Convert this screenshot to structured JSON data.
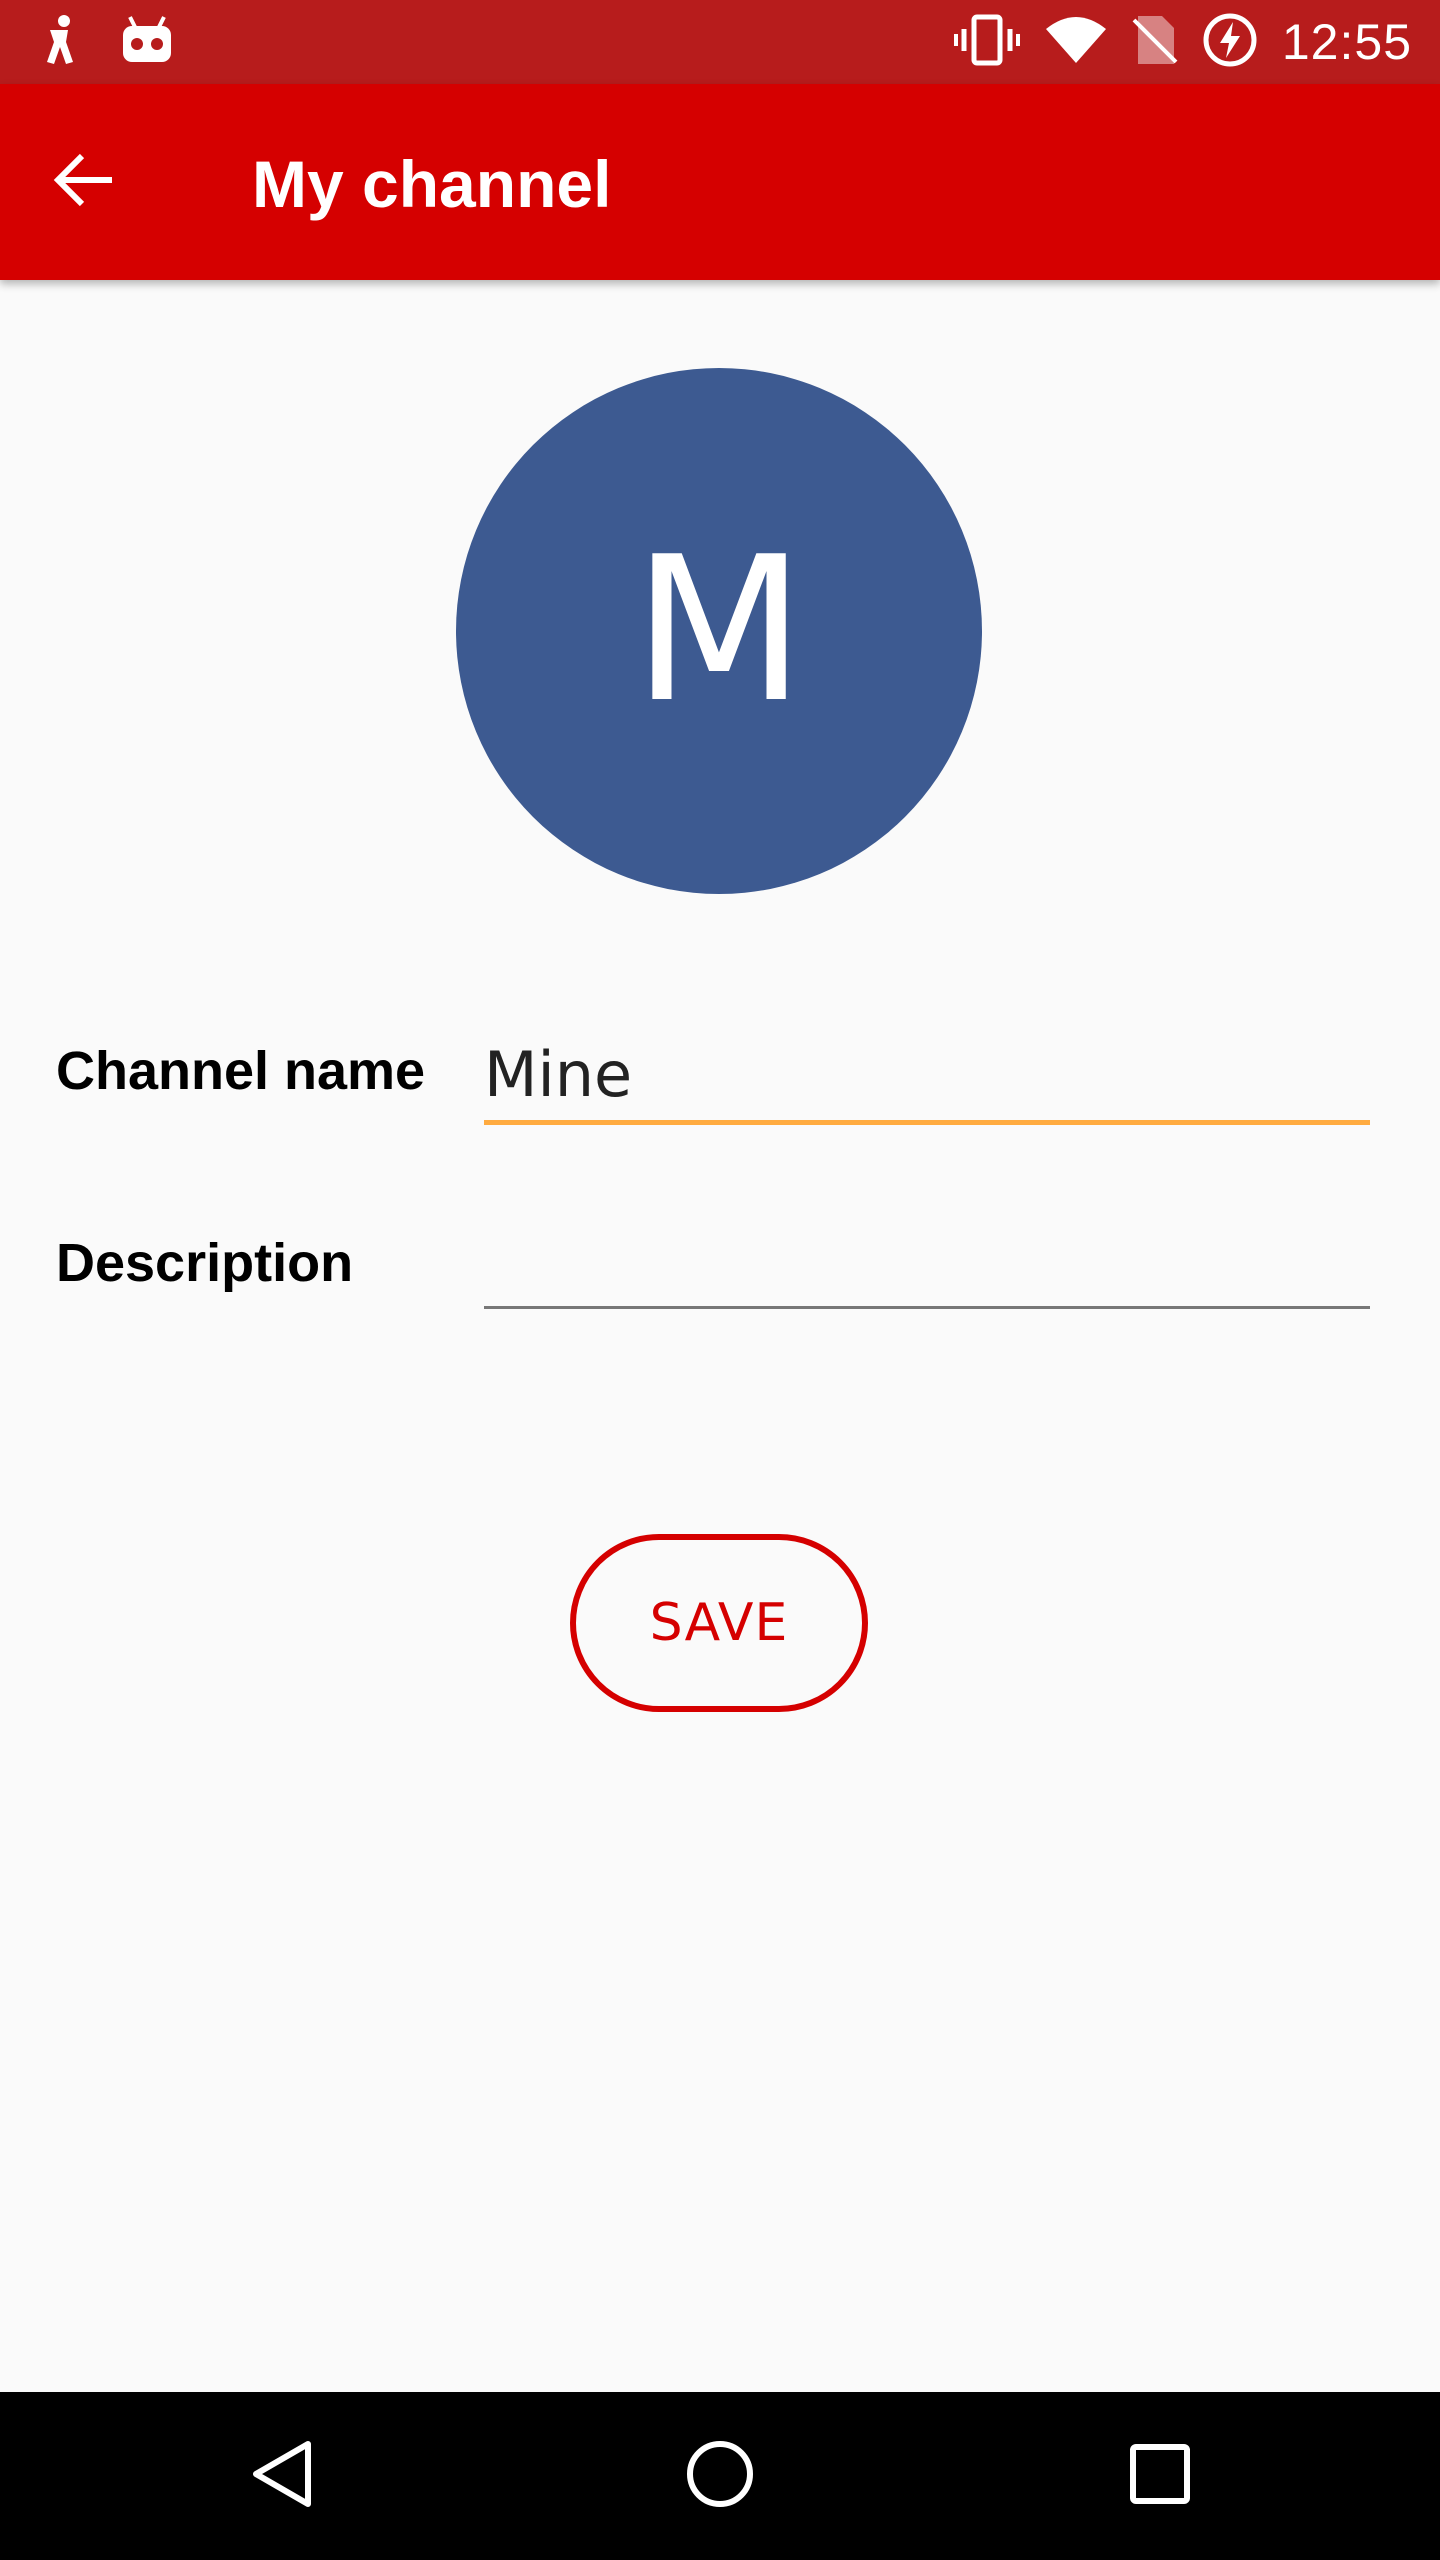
{
  "status_bar": {
    "time": "12:55",
    "left_icons": [
      "person-walk-icon",
      "robot-icon"
    ],
    "right_icons": [
      "vibrate-icon",
      "wifi-icon",
      "no-sim-icon",
      "battery-charging-icon"
    ]
  },
  "app_bar": {
    "title": "My channel",
    "back_icon": "arrow-left-icon",
    "color": "#d50000"
  },
  "avatar": {
    "letter": "M",
    "color": "#3d5a91"
  },
  "form": {
    "channel_name_label": "Channel name",
    "channel_name_value": "Mine",
    "description_label": "Description",
    "description_value": "",
    "focus_color": "#ffab40"
  },
  "save_button": {
    "label": "SAVE"
  },
  "nav_bar": {
    "icons": [
      "back-triangle-icon",
      "home-circle-icon",
      "recents-square-icon"
    ]
  }
}
